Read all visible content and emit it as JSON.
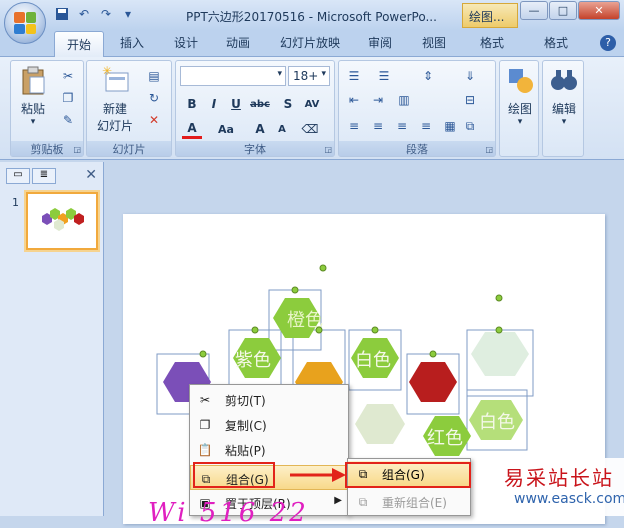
{
  "titlebar": {
    "doc_title": "PPT六边形20170516 - Microsoft PowerPo...",
    "context_tab_title": "绘图...",
    "qat_icons": [
      "save-icon",
      "undo-icon",
      "redo-icon",
      "customize-icon"
    ]
  },
  "tabs": [
    {
      "label": "开始"
    },
    {
      "label": "插入"
    },
    {
      "label": "设计"
    },
    {
      "label": "动画"
    },
    {
      "label": "幻灯片放映"
    },
    {
      "label": "审阅"
    },
    {
      "label": "视图"
    },
    {
      "label": "格式"
    },
    {
      "label": "格式"
    }
  ],
  "ribbon": {
    "clipboard": {
      "label": "剪贴板",
      "paste": "粘贴"
    },
    "slides": {
      "label": "幻灯片",
      "new_slide": "新建",
      "new_slide2": "幻灯片"
    },
    "font": {
      "label": "字体",
      "font_size": "18+"
    },
    "paragraph": {
      "label": "段落"
    },
    "drawing": {
      "label": "绘图"
    },
    "editing": {
      "label": "编辑"
    }
  },
  "slide_panel": {
    "slide_number": "1"
  },
  "slide": {
    "hex_labels": [
      "橙色",
      "紫色",
      "白色",
      "白色",
      "红色"
    ]
  },
  "context_menu": {
    "items": [
      {
        "label": "剪切(T)",
        "icon": "scissors-icon"
      },
      {
        "label": "复制(C)",
        "icon": "copy-icon"
      },
      {
        "label": "粘贴(P)",
        "icon": "paste-icon"
      },
      {
        "label": "组合(G)",
        "icon": "group-icon"
      },
      {
        "label": "置于顶层(R)",
        "icon": "bring-front-icon"
      }
    ]
  },
  "submenu": {
    "items": [
      {
        "label": "组合(G)",
        "icon": "group-icon"
      },
      {
        "label": "重新组合(E)",
        "icon": "regroup-icon"
      }
    ]
  },
  "watermark": {
    "line1": "易采站长站",
    "line2": "www.easck.com"
  },
  "overlay_text": "Wi 516 22",
  "colors": {
    "highlight_red": "#e2231a",
    "hex_green": "#8ccc3d"
  }
}
